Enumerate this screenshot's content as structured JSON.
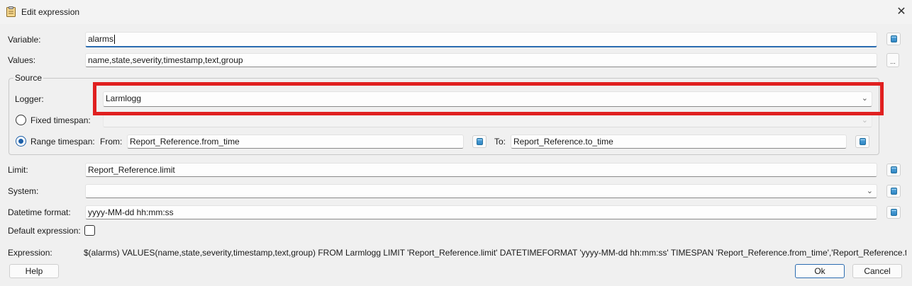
{
  "window": {
    "title": "Edit expression",
    "icon": "clipboard-icon",
    "close_icon": "close-icon"
  },
  "labels": {
    "variable": "Variable:",
    "values": "Values:",
    "source": "Source",
    "logger": "Logger:",
    "fixed_timespan": "Fixed timespan:",
    "range_timespan": "Range timespan:",
    "from": "From:",
    "to": "To:",
    "limit": "Limit:",
    "system": "System:",
    "datetime_format": "Datetime format:",
    "default_expression": "Default expression:",
    "expression": "Expression:"
  },
  "fields": {
    "variable": "alarms",
    "values": "name,state,severity,timestamp,text,group",
    "logger": "Larmlogg",
    "fixed_timespan": "",
    "from": "Report_Reference.from_time",
    "to": "Report_Reference.to_time",
    "limit": "Report_Reference.limit",
    "system": "",
    "datetime_format": "yyyy-MM-dd hh:mm:ss"
  },
  "source": {
    "selected": "range_timespan"
  },
  "default_expression_checked": false,
  "expression_value": "$(alarms) VALUES(name,state,severity,timestamp,text,group) FROM Larmlogg LIMIT 'Report_Reference.limit' DATETIMEFORMAT 'yyyy-MM-dd hh:mm:ss' TIMESPAN 'Report_Reference.from_time','Report_Reference.to_time'",
  "buttons": {
    "help": "Help",
    "ok": "Ok",
    "cancel": "Cancel",
    "values_more": "..."
  },
  "icons": {
    "database": "database-icon",
    "dropdown": "chevron-down-icon"
  },
  "colors": {
    "highlight": "#e02020",
    "accent": "#2b6cb0"
  }
}
